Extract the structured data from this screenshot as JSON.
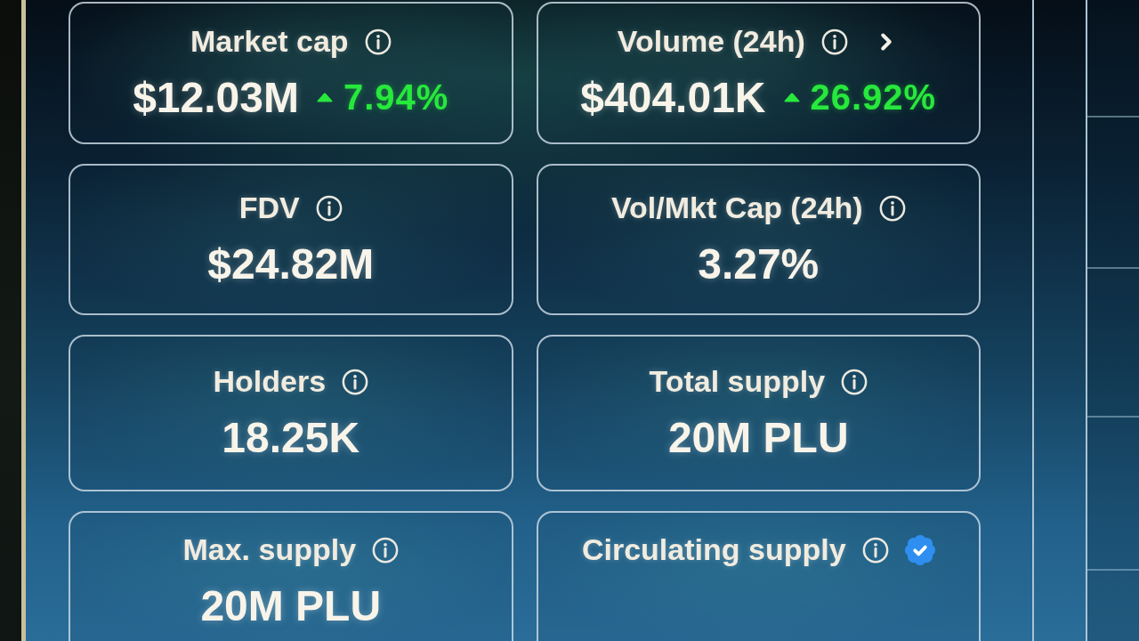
{
  "stat_cards": [
    {
      "label": "Market cap",
      "details_link": false,
      "verified": false,
      "value": "$12.03M",
      "change": {
        "rising": true,
        "text": "7.94%"
      }
    },
    {
      "label": "Volume (24h)",
      "details_link": true,
      "verified": false,
      "value": "$404.01K",
      "change": {
        "rising": true,
        "text": "26.92%"
      }
    },
    {
      "label": "FDV",
      "details_link": false,
      "verified": false,
      "value": "$24.82M"
    },
    {
      "label": "Vol/Mkt Cap (24h)",
      "details_link": false,
      "verified": false,
      "value": "3.27%"
    },
    {
      "label": "Holders",
      "details_link": false,
      "verified": false,
      "value": "18.25K"
    },
    {
      "label": "Total supply",
      "details_link": false,
      "verified": false,
      "value": "20M PLU"
    },
    {
      "label": "Max. supply",
      "details_link": false,
      "verified": false,
      "value": "20M PLU"
    },
    {
      "label": "Circulating supply",
      "details_link": false,
      "verified": true
    }
  ]
}
